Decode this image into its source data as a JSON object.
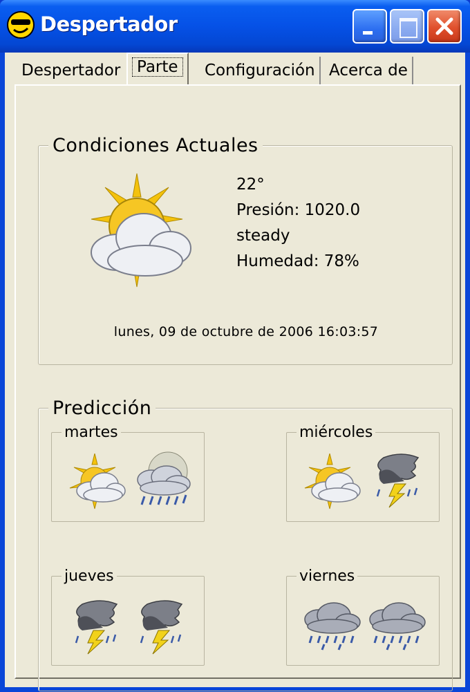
{
  "window": {
    "title": "Despertador",
    "app_icon": "smiley-sunglasses-icon"
  },
  "tabs": [
    {
      "label": "Despertador"
    },
    {
      "label": "Parte",
      "selected": true
    },
    {
      "label": "Configuración"
    },
    {
      "label": "Acerca de"
    }
  ],
  "current": {
    "title": "Condiciones Actuales",
    "icon": "partly-cloudy-sun-icon",
    "temperature": "22°",
    "pressure": "Presión: 1020.0",
    "trend": "steady",
    "humidity": "Humedad: 78%",
    "datetime": "lunes, 09 de octubre de  2006 16:03:57"
  },
  "forecast": {
    "title": "Predicción",
    "days": [
      {
        "name": "martes",
        "day_icon": "partly-cloudy-sun-icon",
        "night_icon": "rain-moon-icon"
      },
      {
        "name": "miércoles",
        "day_icon": "partly-cloudy-sun-icon",
        "night_icon": "thunderstorm-icon"
      },
      {
        "name": "jueves",
        "day_icon": "thunderstorm-icon",
        "night_icon": "thunderstorm-icon"
      },
      {
        "name": "viernes",
        "day_icon": "rain-icon",
        "night_icon": "rain-icon"
      }
    ]
  },
  "colors": {
    "titlebar": "#0551e6",
    "face": "#ece9d8",
    "close": "#e0502c"
  }
}
